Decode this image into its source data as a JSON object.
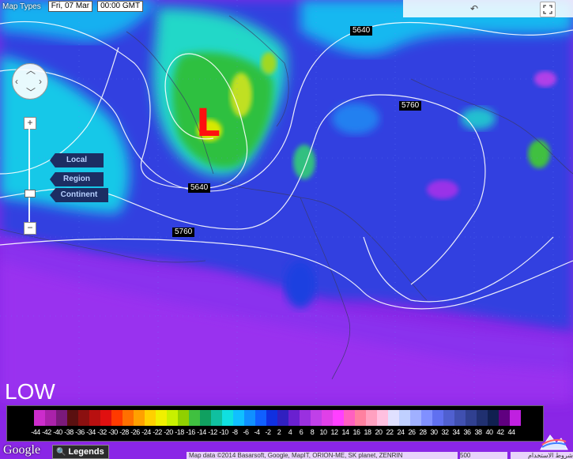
{
  "toolbar": {
    "map_types_label": "Map Types",
    "date": "Fri, 07 Mar",
    "time": "00:00 GMT"
  },
  "map": {
    "rotate_label": "↶",
    "fullscreen_icon": "fullscreen-icon",
    "pan_icon": "pan-control-icon",
    "zoom_in": "+",
    "zoom_out": "−",
    "zoom_buttons": [
      "Local",
      "Region",
      "Continent"
    ],
    "contour_labels": [
      "5640",
      "5760",
      "5640",
      "5760"
    ],
    "low_symbol": "L"
  },
  "legend": {
    "title": "LOW",
    "ticks": [
      "-44",
      "-42",
      "-40",
      "-38",
      "-36",
      "-34",
      "-32",
      "-30",
      "-28",
      "-26",
      "-24",
      "-22",
      "-20",
      "-18",
      "-16",
      "-14",
      "-12",
      "-10",
      "-8",
      "-6",
      "-4",
      "-2",
      "2",
      "4",
      "6",
      "8",
      "10",
      "12",
      "14",
      "16",
      "18",
      "20",
      "22",
      "24",
      "26",
      "28",
      "30",
      "32",
      "34",
      "36",
      "38",
      "40",
      "42",
      "44"
    ],
    "colors": [
      "#cc2ccc",
      "#aa22aa",
      "#7a1a7a",
      "#5a1010",
      "#8b1010",
      "#b81010",
      "#e01010",
      "#ff3a00",
      "#ff7000",
      "#ffa000",
      "#ffd000",
      "#f0f000",
      "#c8f000",
      "#90d000",
      "#40c040",
      "#10a060",
      "#10c0a0",
      "#10e0e0",
      "#10c0ff",
      "#1090ff",
      "#1060ff",
      "#1030e0",
      "#3020c0",
      "#6a20d0",
      "#9a30e0",
      "#c040e8",
      "#e040e8",
      "#ff40ff",
      "#ff60c0",
      "#ff80a0",
      "#ffa0c0",
      "#ffc0e0",
      "#e0e0ff",
      "#c0d0ff",
      "#a0b0ff",
      "#8090ff",
      "#6070f0",
      "#5060d0",
      "#4050b0",
      "#304090",
      "#203070",
      "#102050",
      "#600080",
      "#c020e0"
    ]
  },
  "footer": {
    "google": "Google",
    "legends_button": "Legends",
    "attribution": "Map data ©2014 Basarsoft, Google, MapIT, ORION-ME, SK planet, ZENRIN",
    "scale": "500",
    "terms": "شروط الاستخدام"
  }
}
